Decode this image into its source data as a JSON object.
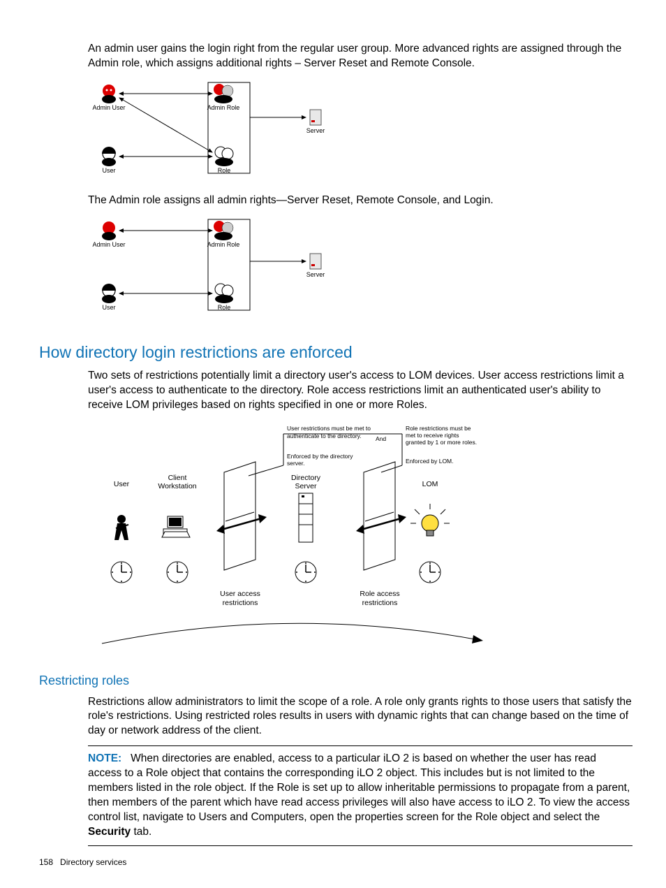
{
  "para1": "An admin user gains the login right from the regular user group. More advanced rights are assigned through the Admin role, which assigns additional rights – Server Reset and Remote Console.",
  "diagram1": {
    "adminUser": "Admin User",
    "adminRole": "Admin Role",
    "user": "User",
    "role": "Role",
    "server": "Server"
  },
  "para2": "The Admin role assigns all admin rights—Server Reset, Remote Console, and Login.",
  "diagram2": {
    "adminUser": "Admin User",
    "adminRole": "Admin Role",
    "user": "User",
    "role": "Role",
    "server": "Server"
  },
  "heading1": "How directory login restrictions are enforced",
  "para3": "Two sets of restrictions potentially limit a directory user's access to LOM devices. User access restrictions limit a user's access to authenticate to the directory. Role access restrictions limit an authenticated user's ability to receive LOM privileges based on rights specified in one or more Roles.",
  "diagram3": {
    "userRestrText1": "User restrictions must be met to",
    "userRestrText2": "authenticate to the directory.",
    "andText": "And",
    "roleRestrText1": "Role restrictions must be",
    "roleRestrText2": "met to receive rights",
    "roleRestrText3": "granted by 1 or more roles.",
    "enforcedDir1": "Enforced by the directory",
    "enforcedDir2": "server.",
    "enforcedLom": "Enforced by LOM.",
    "user": "User",
    "client1": "Client",
    "client2": "Workstation",
    "dirServer1": "Directory",
    "dirServer2": "Server",
    "lom": "LOM",
    "userAccess1": "User access",
    "userAccess2": "restrictions",
    "roleAccess1": "Role access",
    "roleAccess2": "restrictions"
  },
  "heading2": "Restricting roles",
  "para4": "Restrictions allow administrators to limit the scope of a role. A role only grants rights to those users that satisfy the role's restrictions. Using restricted roles results in users with dynamic rights that can change based on the time of day or network address of the client.",
  "noteLabel": "NOTE:",
  "noteText": "When directories are enabled, access to a particular iLO 2 is based on whether the user has read access to a Role object that contains the corresponding iLO 2 object. This includes but is not limited to the members listed in the role object. If the Role is set up to allow inheritable permissions to propagate from a parent, then members of the parent which have read access privileges will also have access to iLO 2. To view the access control list, navigate to Users and Computers, open the properties screen for the Role object and select the ",
  "noteBold": "Security",
  "noteTextAfter": " tab.",
  "pageNum": "158",
  "footerText": "Directory services"
}
